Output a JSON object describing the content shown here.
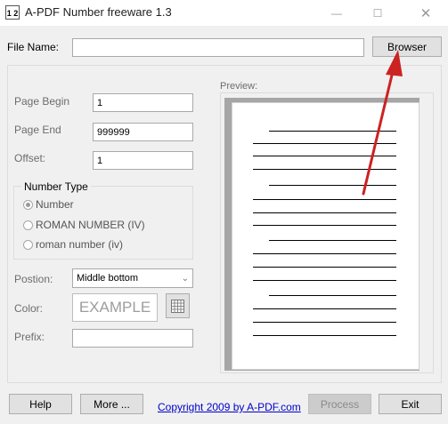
{
  "window": {
    "title": "A-PDF Number freeware 1.3",
    "icon_text": "1 2"
  },
  "file": {
    "label": "File Name:",
    "value": "",
    "browse_label": "Browser"
  },
  "form": {
    "page_begin": {
      "label": "Page Begin",
      "value": "1"
    },
    "page_end": {
      "label": "Page End",
      "value": "999999"
    },
    "offset": {
      "label": "Offset:",
      "value": "1"
    },
    "number_type": {
      "legend": "Number Type",
      "options": [
        "Number",
        "ROMAN NUMBER (IV)",
        "roman number (iv)"
      ],
      "selected": "Number"
    },
    "position": {
      "label": "Postion:",
      "value": "Middle bottom"
    },
    "color": {
      "label": "Color:",
      "example": "EXAMPLE"
    },
    "prefix": {
      "label": "Prefix:",
      "value": ""
    }
  },
  "preview": {
    "label": "Preview:"
  },
  "footer": {
    "help_label": "Help",
    "more_label": "More ...",
    "copyright": "Copyright 2009 by A-PDF.com",
    "process_label": "Process",
    "exit_label": "Exit"
  },
  "icons": [
    "app-icon",
    "minimize-icon",
    "maximize-icon",
    "close-icon",
    "color-grid-icon",
    "chevron-down-icon"
  ],
  "colors": {
    "accent_arrow": "#cc2222",
    "link": "#0000cc"
  }
}
